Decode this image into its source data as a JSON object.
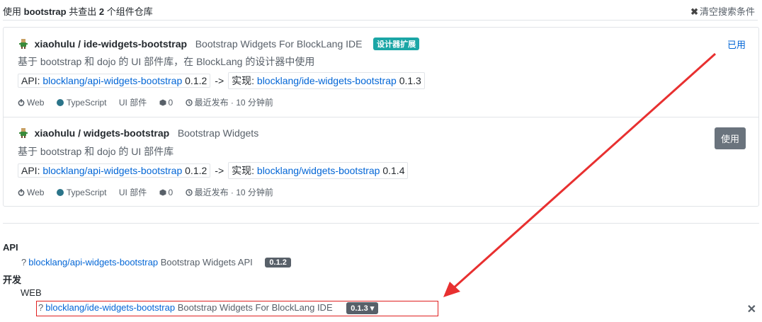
{
  "header": {
    "prefix": "使用",
    "query": "bootstrap",
    "mid": "共查出",
    "count": "2",
    "suffix": "个组件仓库",
    "clear_label": "清空搜索条件"
  },
  "results": [
    {
      "owner_repo": "xiaohulu / ide-widgets-bootstrap",
      "title_desc": "Bootstrap Widgets For BlockLang IDE",
      "category_badge": "设计器扩展",
      "description": "基于 bootstrap 和 dojo 的 UI 部件库，在 BlockLang 的设计器中使用",
      "api_label": "API:",
      "api_repo": "blocklang/api-widgets-bootstrap",
      "api_version": "0.1.2",
      "arrow": "->",
      "impl_label": "实现:",
      "impl_repo": "blocklang/ide-widgets-bootstrap",
      "impl_version": "0.1.3",
      "platform": "Web",
      "language": "TypeScript",
      "type": "UI 部件",
      "count": "0",
      "published": "最近发布 · 10 分钟前",
      "action": "已用",
      "action_type": "label"
    },
    {
      "owner_repo": "xiaohulu / widgets-bootstrap",
      "title_desc": "Bootstrap Widgets",
      "category_badge": "",
      "description": "基于 bootstrap 和 dojo 的 UI 部件库",
      "api_label": "API:",
      "api_repo": "blocklang/api-widgets-bootstrap",
      "api_version": "0.1.2",
      "arrow": "->",
      "impl_label": "实现:",
      "impl_repo": "blocklang/widgets-bootstrap",
      "impl_version": "0.1.4",
      "platform": "Web",
      "language": "TypeScript",
      "type": "UI 部件",
      "count": "0",
      "published": "最近发布 · 10 分钟前",
      "action": "使用",
      "action_type": "button"
    }
  ],
  "tree": {
    "api_group": "API",
    "api_item": {
      "icon": "?",
      "repo": "blocklang/api-widgets-bootstrap",
      "desc": "Bootstrap Widgets API",
      "version": "0.1.2"
    },
    "dev_group": "开发",
    "web_group": "WEB",
    "web_item": {
      "icon": "?",
      "repo": "blocklang/ide-widgets-bootstrap",
      "desc": "Bootstrap Widgets For BlockLang IDE",
      "version": "0.1.3",
      "caret": "▾"
    },
    "close": "✕"
  },
  "colors": {
    "link": "#0366d6",
    "category_badge": "#1ba6a6",
    "typescript_dot": "#2b7489",
    "annotation_red": "#e02020"
  }
}
